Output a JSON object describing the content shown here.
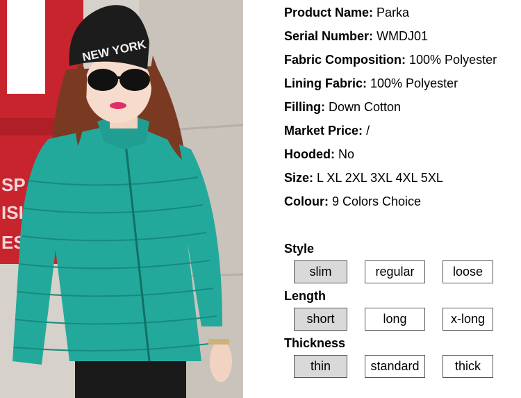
{
  "photo": {
    "hat_text": "NEW YORK",
    "sign_text": [
      "SP",
      "ISI",
      "ES"
    ],
    "colors": {
      "jacket": "#20a89a",
      "hat": "#1c1c1c",
      "hair": "#7a3a22",
      "wall": "#d4cfc8",
      "sign": "#c8242e"
    }
  },
  "specs": [
    {
      "label": "Product Name:",
      "value": "Parka"
    },
    {
      "label": "Serial Number:",
      "value": "WMDJ01"
    },
    {
      "label": "Fabric Composition:",
      "value": "100% Polyester"
    },
    {
      "label": "Lining Fabric:",
      "value": "100% Polyester"
    },
    {
      "label": "Filling:",
      "value": "Down Cotton"
    },
    {
      "label": "Market Price:",
      "value": "/"
    },
    {
      "label": "Hooded:",
      "value": "No"
    },
    {
      "label": "Size:",
      "value": "L XL 2XL 3XL 4XL 5XL"
    },
    {
      "label": "Colour:",
      "value": "9 Colors Choice"
    }
  ],
  "groups": [
    {
      "title": "Style",
      "options": [
        "slim",
        "regular",
        "loose"
      ],
      "selected": "slim"
    },
    {
      "title": "Length",
      "options": [
        "short",
        "long",
        "x-long"
      ],
      "selected": "short"
    },
    {
      "title": "Thickness",
      "options": [
        "thin",
        "standard",
        "thick"
      ],
      "selected": "thin"
    }
  ]
}
